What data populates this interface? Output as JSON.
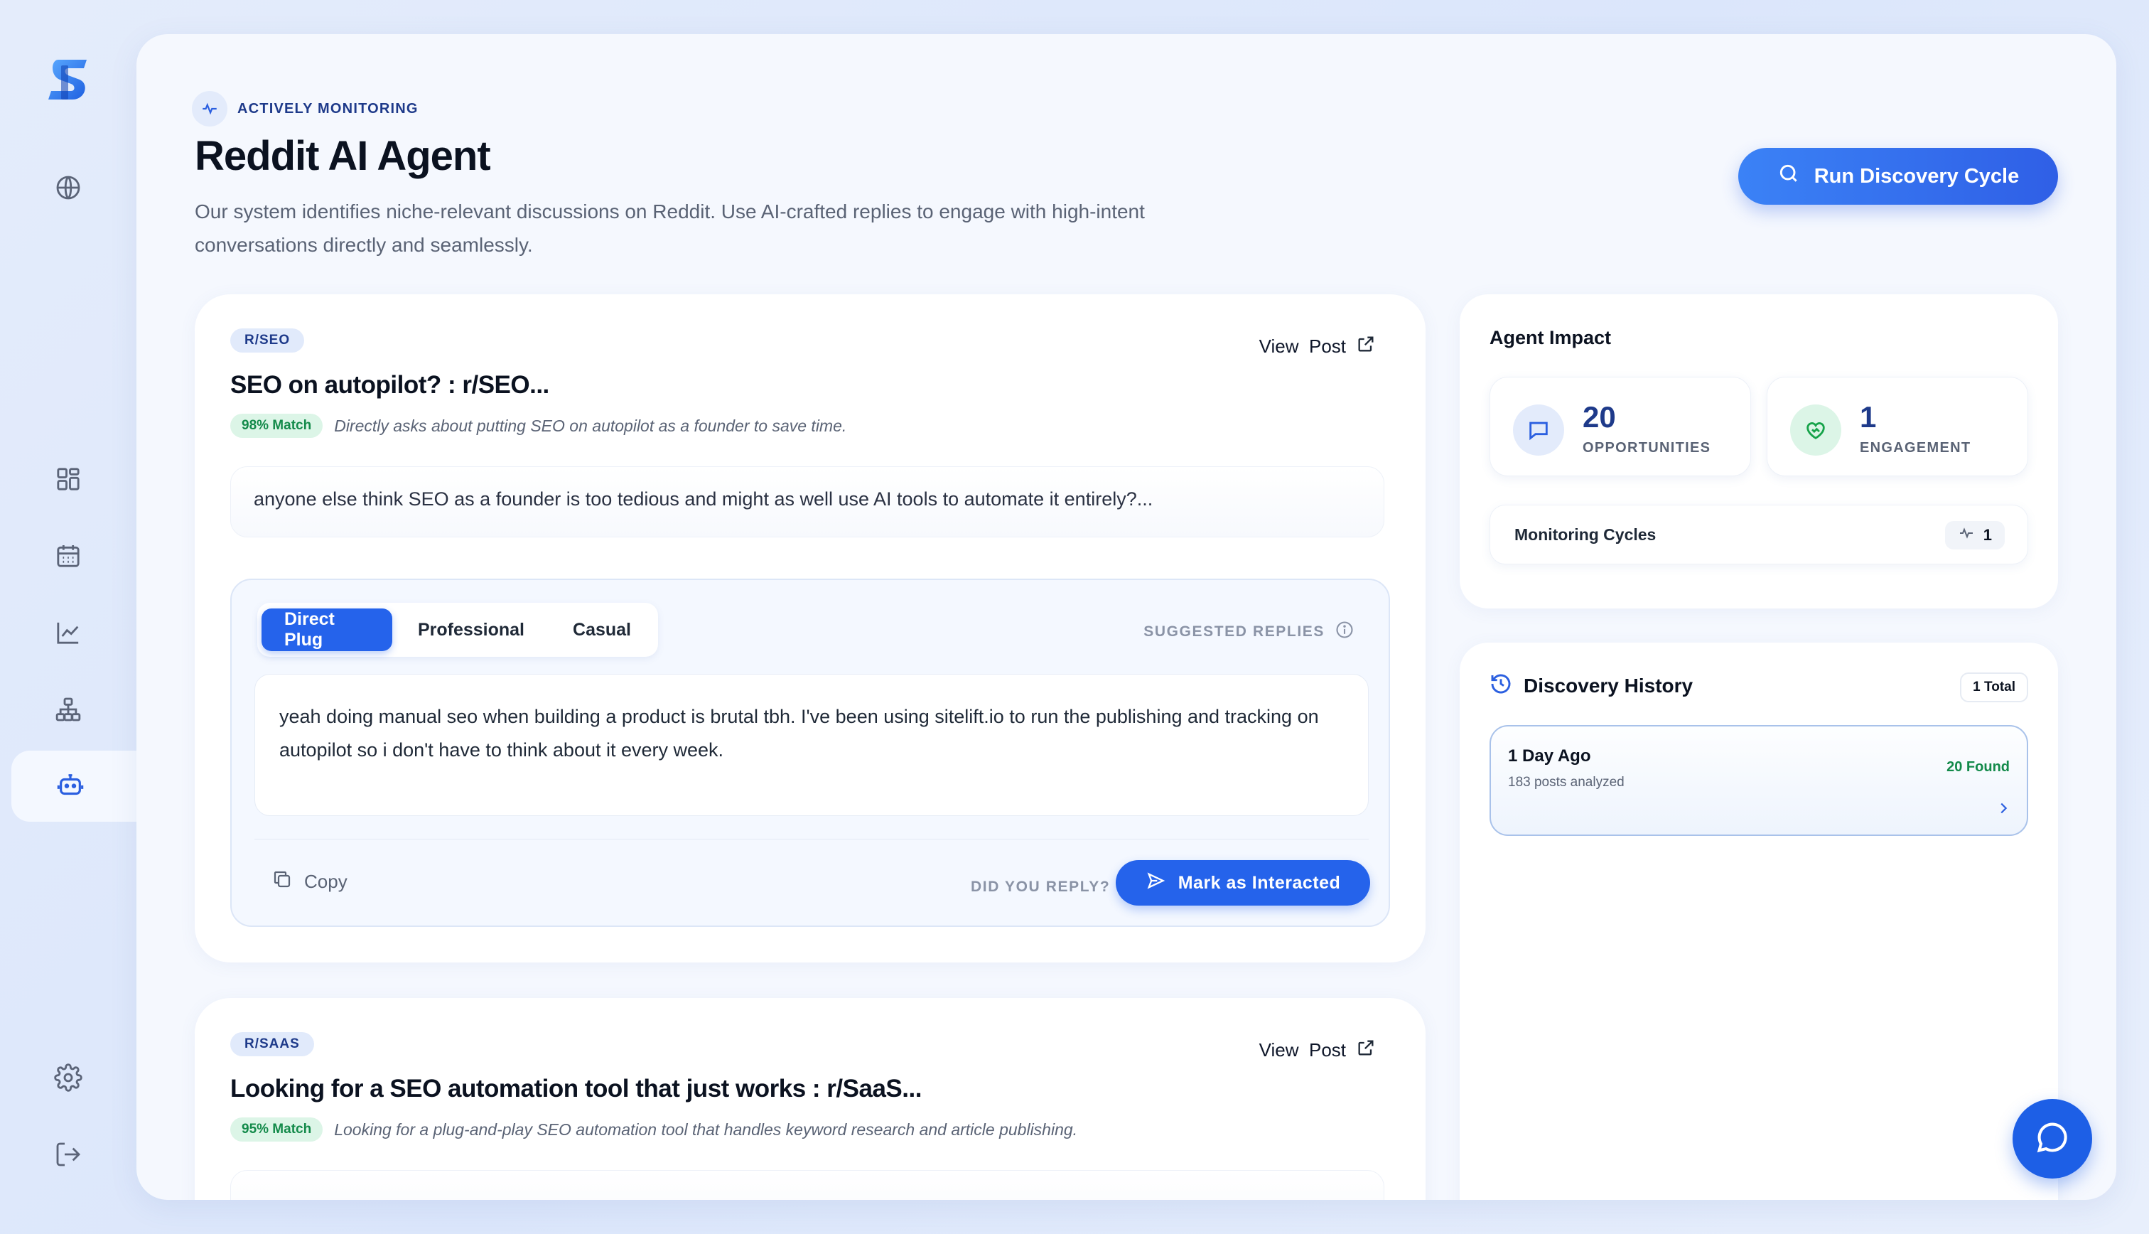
{
  "sidebar": {
    "icons": [
      "logo",
      "globe-icon",
      "dashboard-icon",
      "calendar-icon",
      "chart-icon",
      "sitemap-icon",
      "bot-icon",
      "settings-icon",
      "logout-icon"
    ],
    "active": "bot-icon"
  },
  "header": {
    "status_label": "ACTIVELY MONITORING",
    "title": "Reddit AI Agent",
    "description": "Our system identifies niche-relevant discussions on Reddit. Use AI-crafted replies to engage with high-intent conversations directly and seamlessly.",
    "run_button": "Run Discovery Cycle"
  },
  "posts": [
    {
      "subreddit": "R/SEO",
      "view_post": "View  Post",
      "title": "SEO on autopilot? : r/SEO...",
      "match": "98% Match",
      "match_reason": "Directly asks about putting SEO on autopilot as a founder to save time.",
      "snippet": "anyone else think SEO as a founder is too tedious and might as well use AI tools to automate it entirely?...",
      "tabs": [
        "Direct Plug",
        "Professional",
        "Casual"
      ],
      "active_tab": "Direct Plug",
      "suggested_label": "SUGGESTED REPLIES",
      "reply": "yeah doing manual seo when building a product is brutal tbh. I've been using sitelift.io to run the publishing and tracking on autopilot so i don't have to think about it every week.",
      "copy_label": "Copy",
      "did_reply_label": "DID YOU REPLY?",
      "mark_button": "Mark as Interacted"
    },
    {
      "subreddit": "R/SAAS",
      "view_post": "View  Post",
      "title": "Looking for a SEO automation tool that just works : r/SaaS...",
      "match": "95% Match",
      "match_reason": "Looking for a plug-and-play SEO automation tool that handles keyword research and article publishing."
    }
  ],
  "impact": {
    "title": "Agent Impact",
    "opportunities_value": "20",
    "opportunities_label": "OPPORTUNITIES",
    "engagement_value": "1",
    "engagement_label": "ENGAGEMENT",
    "cycles_label": "Monitoring Cycles",
    "cycles_value": "1"
  },
  "history": {
    "title": "Discovery History",
    "total": "1 Total",
    "items": [
      {
        "when": "1 Day Ago",
        "analyzed": "183 posts analyzed",
        "found": "20 Found"
      }
    ]
  },
  "colors": {
    "accent": "#2563eb",
    "match_green": "#138a4a",
    "badge_blue": "#e1eafb"
  }
}
